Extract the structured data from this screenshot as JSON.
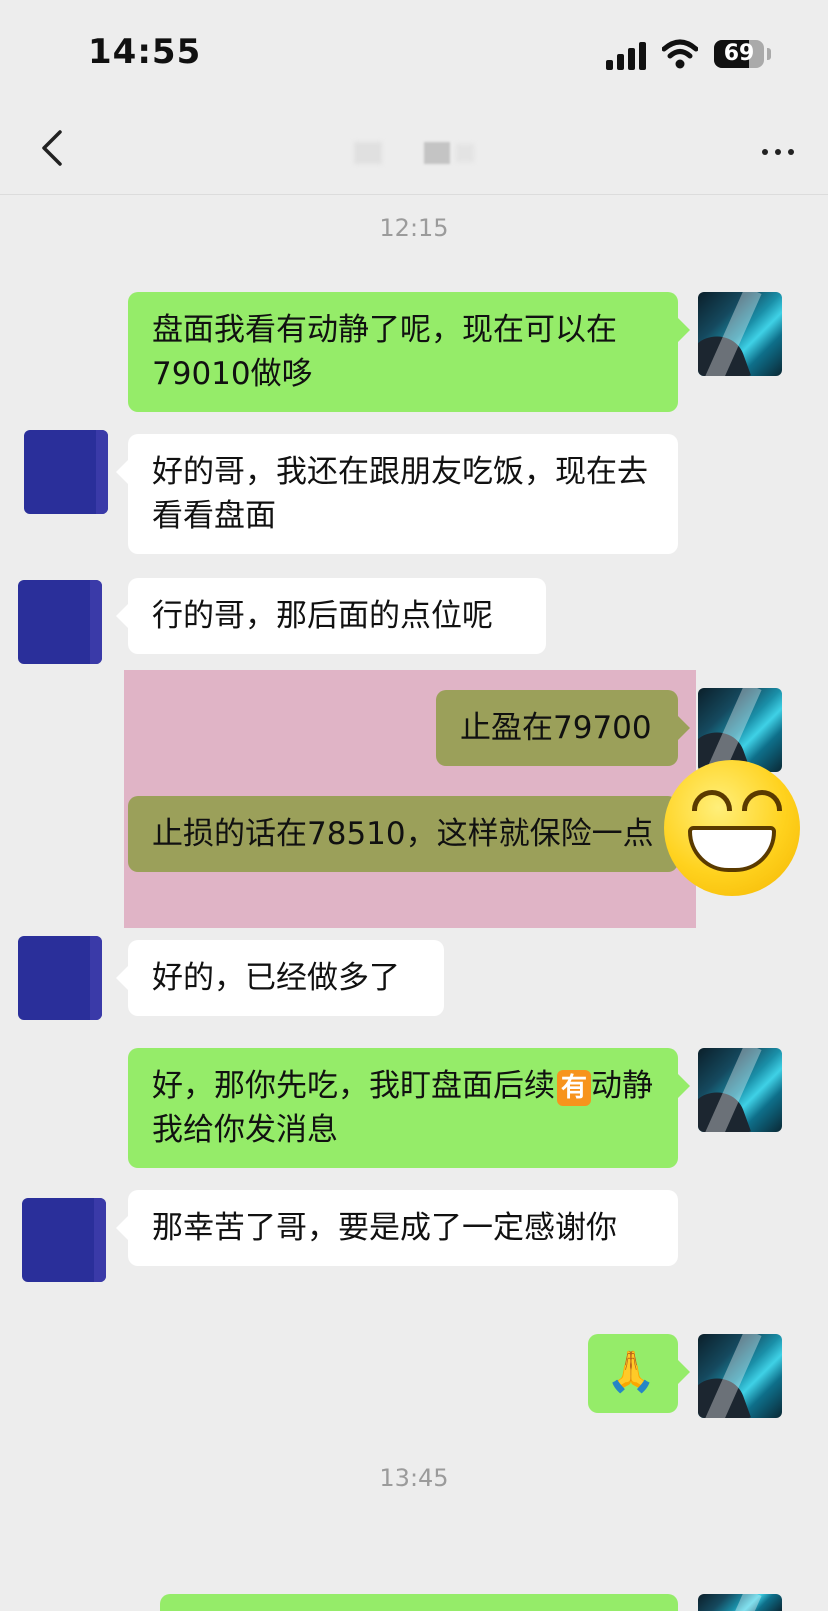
{
  "status_bar": {
    "time": "14:55",
    "battery": "69",
    "battery_level": 0.69
  },
  "nav": {
    "back_icon": "chevron-left-icon",
    "more_icon": "ellipsis-icon"
  },
  "timestamps": [
    "12:15",
    "13:45"
  ],
  "messages": [
    {
      "side": "right",
      "text": "盘面我看有动静了呢，现在可以在79010做哆"
    },
    {
      "side": "left",
      "text": "好的哥，我还在跟朋友吃饭，现在去看看盘面"
    },
    {
      "side": "left",
      "text": "行的哥，那后面的点位呢"
    },
    {
      "side": "right",
      "text": "止盈在79700"
    },
    {
      "side": "right",
      "text": "止损的话在78510，这样就保险一点"
    },
    {
      "side": "left",
      "text": "好的，已经做多了"
    },
    {
      "side": "right",
      "text": "好，那你先吃，我盯盘面后续",
      "badge": "有",
      "text_after": "动静我给你发消息"
    },
    {
      "side": "left",
      "text": "那幸苦了哥，要是成了一定感谢你"
    },
    {
      "side": "right",
      "text": "🙏"
    }
  ],
  "sticker": "grinning-face-emoji",
  "colors": {
    "background": "#ededed",
    "bubble_sent": "#95ec69",
    "bubble_received": "#ffffff",
    "highlight": "#e0b4c6"
  }
}
